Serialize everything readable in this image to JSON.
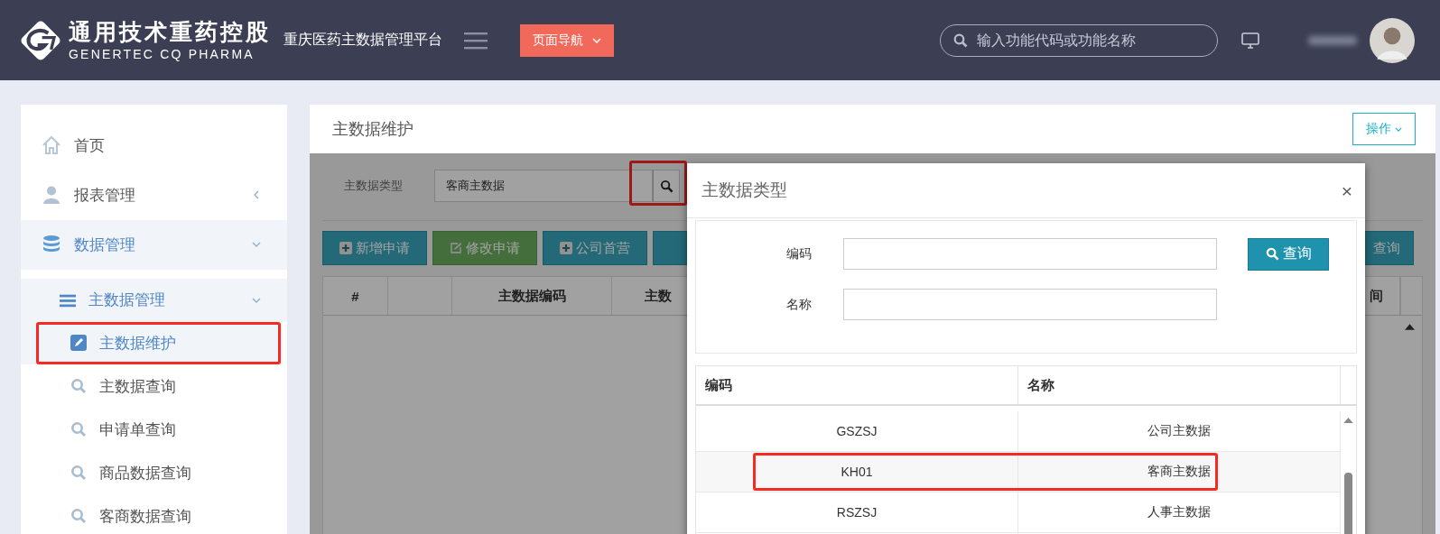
{
  "header": {
    "logo_title": "通用技术重药控股",
    "logo_subtitle": "GENERTEC CQ PHARMA",
    "platform": "重庆医药主数据管理平台",
    "nav_button": "页面导航",
    "search": {
      "placeholder": "输入功能代码或功能名称"
    }
  },
  "sidebar": {
    "items": [
      {
        "label": "首页"
      },
      {
        "label": "报表管理",
        "expanded": false
      },
      {
        "label": "数据管理",
        "expanded": true,
        "children": [
          {
            "label": "主数据管理",
            "expanded": true,
            "children": [
              {
                "label": "主数据维护",
                "selected": true
              },
              {
                "label": "主数据查询",
                "selected": false
              },
              {
                "label": "申请单查询",
                "selected": false
              },
              {
                "label": "商品数据查询",
                "selected": false
              },
              {
                "label": "客商数据查询",
                "selected": false
              }
            ]
          }
        ]
      }
    ]
  },
  "page": {
    "title": "主数据维护",
    "action_button": "操作",
    "filter": {
      "label": "主数据类型",
      "value": "客商主数据"
    },
    "toolbar": [
      {
        "label": "新增申请",
        "kind": "add"
      },
      {
        "label": "修改申请",
        "kind": "edit"
      },
      {
        "label": "公司首营",
        "kind": "add"
      }
    ],
    "query_button": "查询",
    "columns": [
      "#",
      "主数据编码",
      "主数"
    ],
    "column_cut_right": "间"
  },
  "dialog": {
    "title": "主数据类型",
    "close": "×",
    "fields": [
      {
        "label": "编码"
      },
      {
        "label": "名称"
      }
    ],
    "search_button": "查询",
    "table": {
      "columns": [
        "编码",
        "名称"
      ],
      "rows": [
        {
          "code": "GSZSJ",
          "name": "公司主数据",
          "selected": false
        },
        {
          "code": "KH01",
          "name": "客商主数据",
          "selected": true
        },
        {
          "code": "RSZSJ",
          "name": "人事主数据",
          "selected": false
        }
      ]
    }
  }
}
